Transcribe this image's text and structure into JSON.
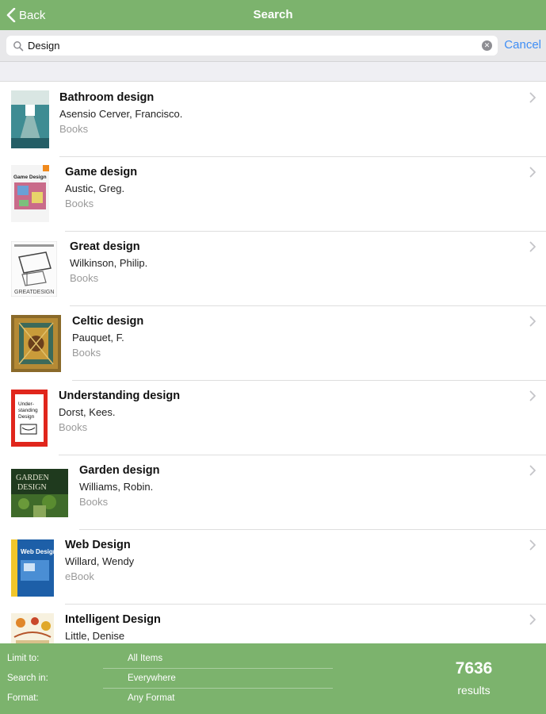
{
  "nav": {
    "back_label": "Back",
    "title": "Search"
  },
  "search": {
    "value": "Design",
    "cancel_label": "Cancel"
  },
  "results": [
    {
      "title": "Bathroom design",
      "author": "Asensio Cerver, Francisco.",
      "format": "Books",
      "cover_icon": "bathroom-cover"
    },
    {
      "title": "Game design",
      "author": "Austic, Greg.",
      "format": "Books",
      "cover_icon": "game-design-cover"
    },
    {
      "title": "Great design",
      "author": "Wilkinson, Philip.",
      "format": "Books",
      "cover_icon": "great-design-cover"
    },
    {
      "title": "Celtic design",
      "author": "Pauquet, F.",
      "format": "Books",
      "cover_icon": "celtic-design-cover"
    },
    {
      "title": "Understanding design",
      "author": "Dorst, Kees.",
      "format": "Books",
      "cover_icon": "understanding-design-cover"
    },
    {
      "title": "Garden design",
      "author": "Williams, Robin.",
      "format": "Books",
      "cover_icon": "garden-design-cover"
    },
    {
      "title": "Web Design",
      "author": "Willard, Wendy",
      "format": "eBook",
      "cover_icon": "web-design-cover"
    },
    {
      "title": "Intelligent Design",
      "author": "Little, Denise",
      "format": "",
      "cover_icon": "intelligent-design-cover"
    }
  ],
  "covers": {
    "game": "Game Design",
    "great": "GREATDESIGN",
    "understanding": [
      "Under-",
      "standing",
      "Design"
    ],
    "garden": [
      "GARDEN",
      "DESIGN"
    ],
    "web": "Web Design"
  },
  "footer": {
    "limit_label": "Limit to:",
    "limit_value": "All Items",
    "search_in_label": "Search in:",
    "search_in_value": "Everywhere",
    "format_label": "Format:",
    "format_value": "Any Format",
    "count": "7636",
    "count_label": "results"
  },
  "colors": {
    "bar_green": "#7cb36d",
    "link_blue": "#3f8ef5",
    "secondary_gray": "#9a9a9a"
  }
}
